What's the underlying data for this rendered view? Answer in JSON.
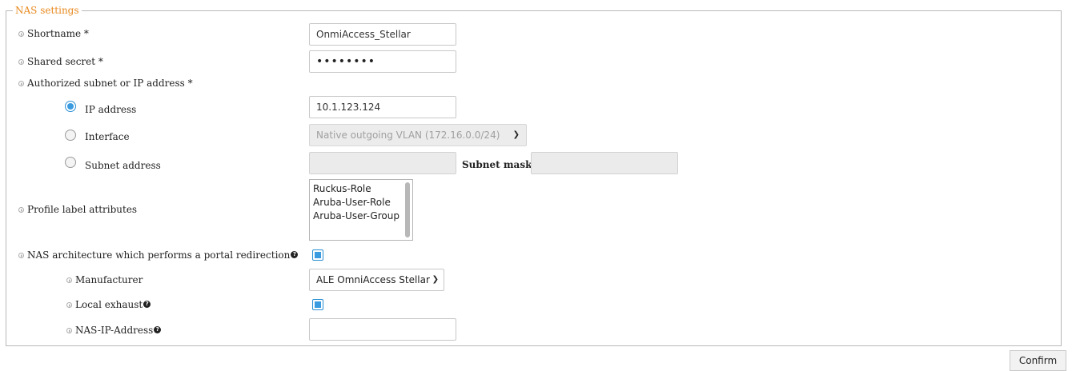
{
  "fieldset": {
    "legend": "NAS settings"
  },
  "labels": {
    "shortname": "Shortname *",
    "shared_secret": "Shared secret *",
    "authorized_subnet": "Authorized subnet or IP address *",
    "ip_address": "IP address",
    "interface": "Interface",
    "subnet_address": "Subnet address",
    "subnet_mask": "Subnet mask",
    "profile_label_attributes": "Profile label attributes",
    "nas_architecture": "NAS architecture which performs a portal redirection",
    "manufacturer": "Manufacturer",
    "local_exhaust": "Local exhaust",
    "nas_ip_address": "NAS-IP-Address"
  },
  "values": {
    "shortname": "OnmiAccess_Stellar",
    "shared_secret": "••••••••",
    "ip_address": "10.1.123.124",
    "interface": "Native outgoing VLAN (172.16.0.0/24)",
    "subnet_address": "",
    "subnet_mask": "",
    "manufacturer": "ALE OmniAccess Stellar",
    "nas_ip_address": ""
  },
  "selected_mode": "ip_address",
  "checkboxes": {
    "nas_architecture": true,
    "local_exhaust": true
  },
  "profile_attributes": [
    "Ruckus-Role",
    "Aruba-User-Role",
    "Aruba-User-Group"
  ],
  "buttons": {
    "confirm": "Confirm"
  },
  "icons": {
    "bullet": "circle-arrow-right-icon",
    "help": "question-circle-icon",
    "dropdown": "chevron-down-icon"
  },
  "colors": {
    "legend": "#e8891e",
    "accent": "#3a9be0"
  }
}
